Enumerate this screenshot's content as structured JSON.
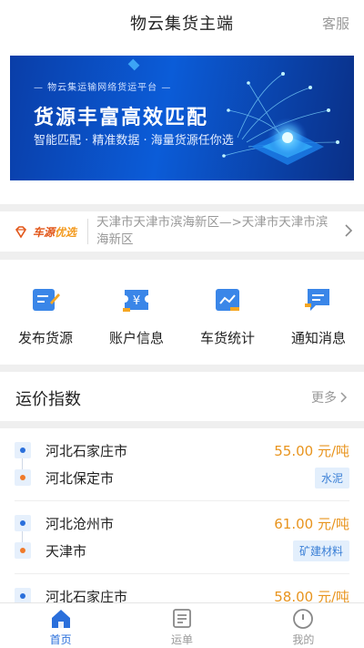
{
  "header": {
    "title": "物云集货主端",
    "service_label": "客服"
  },
  "banner": {
    "subtitle": "— 物云集运输网络货运平台 —",
    "headline": "货源丰富高效匹配",
    "description": "智能匹配 · 精准数据 · 海量货源任你选"
  },
  "notice": {
    "brand_part1": "车源",
    "brand_part2": "优选",
    "text": "天津市天津市滨海新区—>天津市天津市滨海新区"
  },
  "actions": [
    {
      "label": "发布货源",
      "icon": "publish-icon"
    },
    {
      "label": "账户信息",
      "icon": "wallet-icon"
    },
    {
      "label": "车货统计",
      "icon": "chart-icon"
    },
    {
      "label": "通知消息",
      "icon": "message-icon"
    }
  ],
  "price_index": {
    "title": "运价指数",
    "more_label": "更多",
    "routes": [
      {
        "from": "河北石家庄市",
        "to": "河北保定市",
        "price": "55.00 元/吨",
        "tag": "水泥"
      },
      {
        "from": "河北沧州市",
        "to": "天津市",
        "price": "61.00 元/吨",
        "tag": "矿建材料"
      },
      {
        "from": "河北石家庄市",
        "to": "",
        "price": "58.00 元/吨",
        "tag": ""
      }
    ]
  },
  "tabbar": {
    "tabs": [
      {
        "label": "首页",
        "icon": "home-icon",
        "active": true
      },
      {
        "label": "运单",
        "icon": "waybill-icon",
        "active": false
      },
      {
        "label": "我的",
        "icon": "profile-icon",
        "active": false
      }
    ]
  },
  "colors": {
    "accent": "#2a6fdb",
    "price": "#e8941e",
    "brand_orange": "#e2571a"
  }
}
